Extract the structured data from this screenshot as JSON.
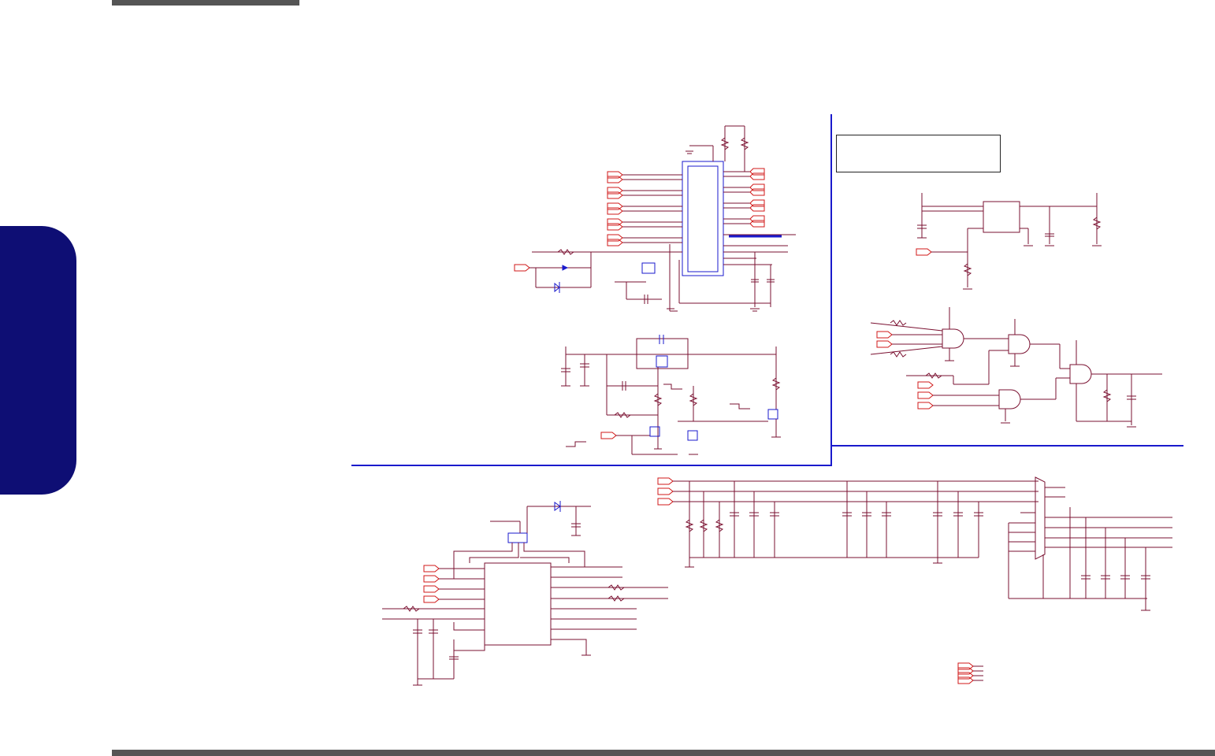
{
  "colors": {
    "page_background": "#ffffff",
    "header_bar": "#555555",
    "footer_bar": "#555555",
    "side_tab": "#0e0e74",
    "wire": "#7a1030",
    "port": "#d01818",
    "component_blue": "#1a1acc",
    "section_divider": "#1a1acc"
  }
}
